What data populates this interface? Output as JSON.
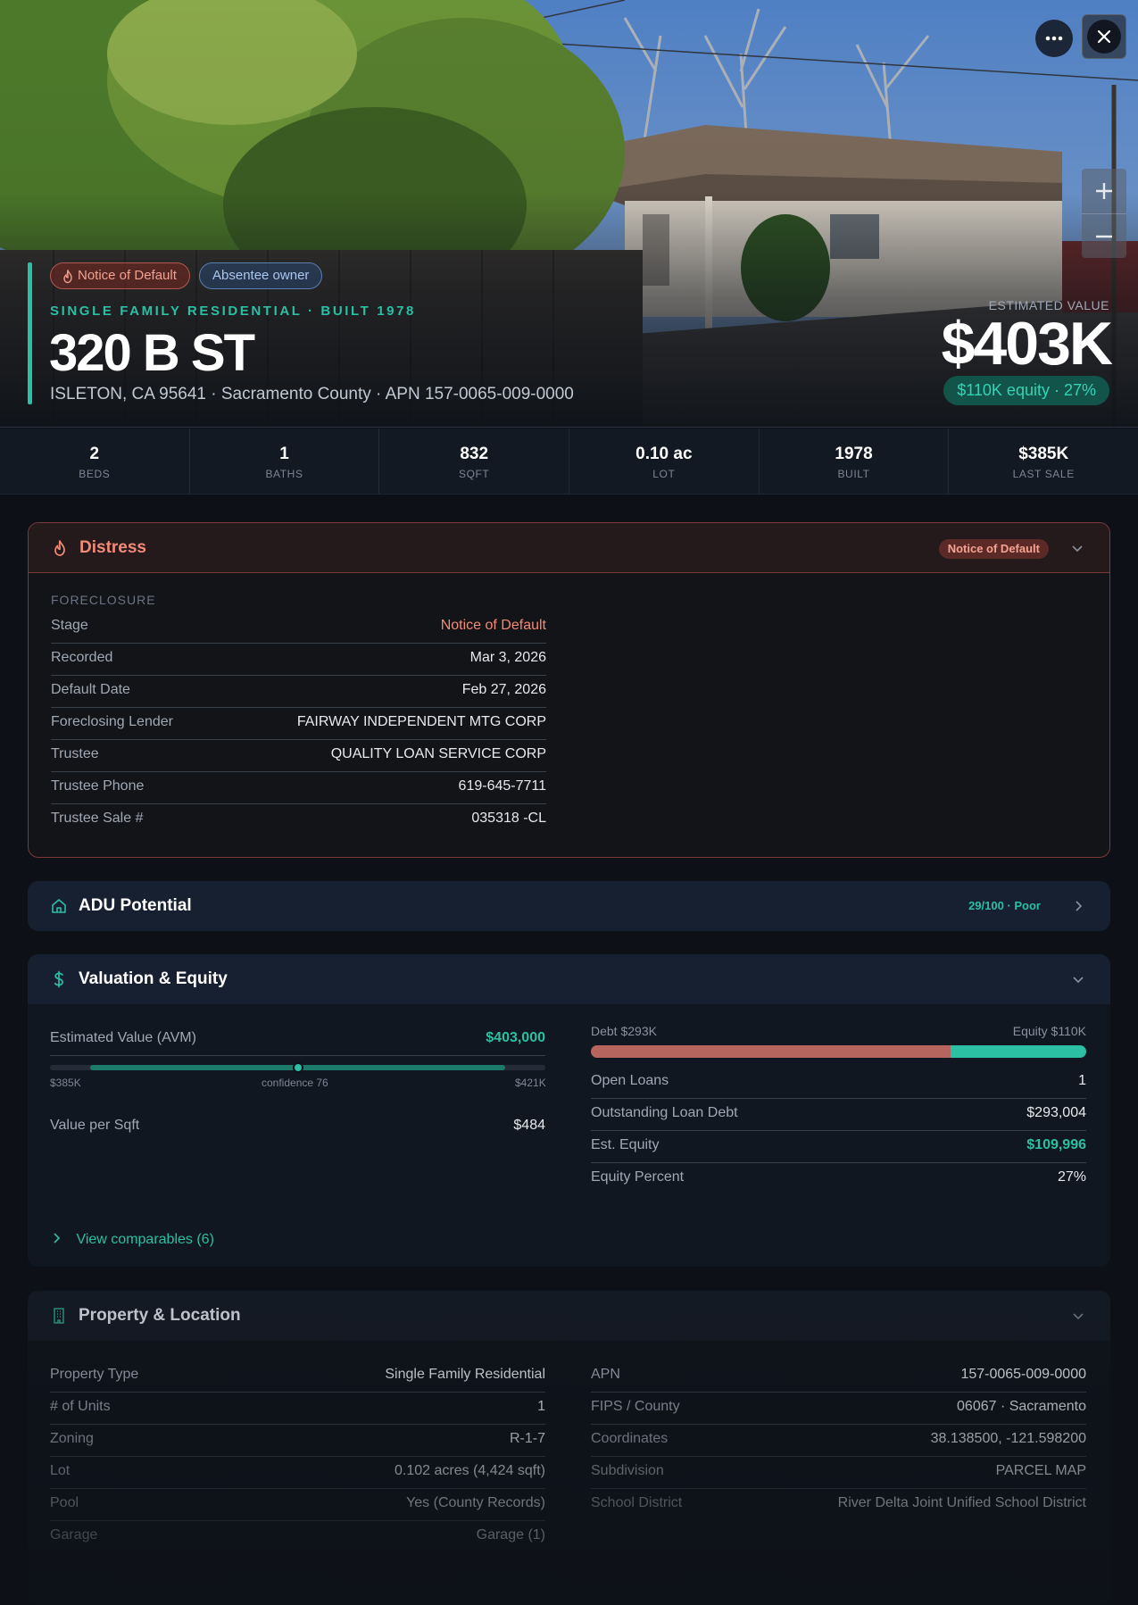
{
  "hero": {
    "badges": {
      "notice_of_default": "Notice of Default",
      "absentee_owner": "Absentee owner"
    },
    "subtitle": "SINGLE FAMILY RESIDENTIAL · BUILT 1978",
    "address": "320 B ST",
    "location": "ISLETON, CA 95641 · Sacramento County · APN 157-0065-009-0000",
    "estimated_value_label": "ESTIMATED VALUE",
    "estimated_value": "$403K",
    "equity_pill": "$110K equity · 27%",
    "icons": {
      "more": "more-icon",
      "close": "close-icon",
      "zoom_in": "plus-icon",
      "zoom_out": "minus-icon"
    }
  },
  "stats": [
    {
      "value": "2",
      "label": "BEDS"
    },
    {
      "value": "1",
      "label": "BATHS"
    },
    {
      "value": "832",
      "label": "SQFT"
    },
    {
      "value": "0.10 ac",
      "label": "LOT"
    },
    {
      "value": "1978",
      "label": "BUILT"
    },
    {
      "value": "$385K",
      "label": "LAST SALE"
    }
  ],
  "distress": {
    "title": "Distress",
    "pill": "Notice of Default",
    "section": "FORECLOSURE",
    "rows": [
      {
        "k": "Stage",
        "v": "Notice of Default"
      },
      {
        "k": "Recorded",
        "v": "Mar 3, 2026"
      },
      {
        "k": "Default Date",
        "v": "Feb 27, 2026"
      },
      {
        "k": "Foreclosing Lender",
        "v": "FAIRWAY INDEPENDENT MTG CORP"
      },
      {
        "k": "Trustee",
        "v": "QUALITY LOAN SERVICE CORP"
      },
      {
        "k": "Trustee Phone",
        "v": "619-645-7711"
      },
      {
        "k": "Trustee Sale #",
        "v": "035318 -CL"
      }
    ]
  },
  "adu": {
    "title": "ADU Potential",
    "score": "29/100 · Poor"
  },
  "valuation": {
    "title": "Valuation & Equity",
    "avm_label": "Estimated Value (AVM)",
    "avm_value": "$403,000",
    "range_low": "$385K",
    "range_mid": "confidence 76",
    "range_high": "$421K",
    "confidence": 76,
    "value_per_sqft_label": "Value per Sqft",
    "value_per_sqft": "$484",
    "debt_label": "Debt $293K",
    "equity_label": "Equity $110K",
    "debt_share": 0.727,
    "rows": [
      {
        "k": "Open Loans",
        "v": "1"
      },
      {
        "k": "Outstanding Loan Debt",
        "v": "$293,004"
      },
      {
        "k": "Est. Equity",
        "v": "$109,996"
      },
      {
        "k": "Equity Percent",
        "v": "27%"
      }
    ],
    "comparables_link": "View comparables (6)"
  },
  "property": {
    "title": "Property & Location",
    "left": [
      {
        "k": "Property Type",
        "v": "Single Family Residential"
      },
      {
        "k": "# of Units",
        "v": "1"
      },
      {
        "k": "Zoning",
        "v": "R-1-7"
      },
      {
        "k": "Lot",
        "v": "0.102 acres (4,424 sqft)"
      },
      {
        "k": "Pool",
        "v": "Yes (County Records)"
      },
      {
        "k": "Garage",
        "v": "Garage (1)"
      }
    ],
    "right": [
      {
        "k": "APN",
        "v": "157-0065-009-0000"
      },
      {
        "k": "FIPS / County",
        "v": "06067 · Sacramento"
      },
      {
        "k": "Coordinates",
        "v": "38.138500, -121.598200"
      },
      {
        "k": "Subdivision",
        "v": "PARCEL MAP"
      },
      {
        "k": "School District",
        "v": "River Delta Joint Unified School District"
      }
    ]
  },
  "colors": {
    "accent": "#2bbfa4",
    "distress": "#f28a78",
    "debt": "#b5655d",
    "background": "#0d1117"
  }
}
